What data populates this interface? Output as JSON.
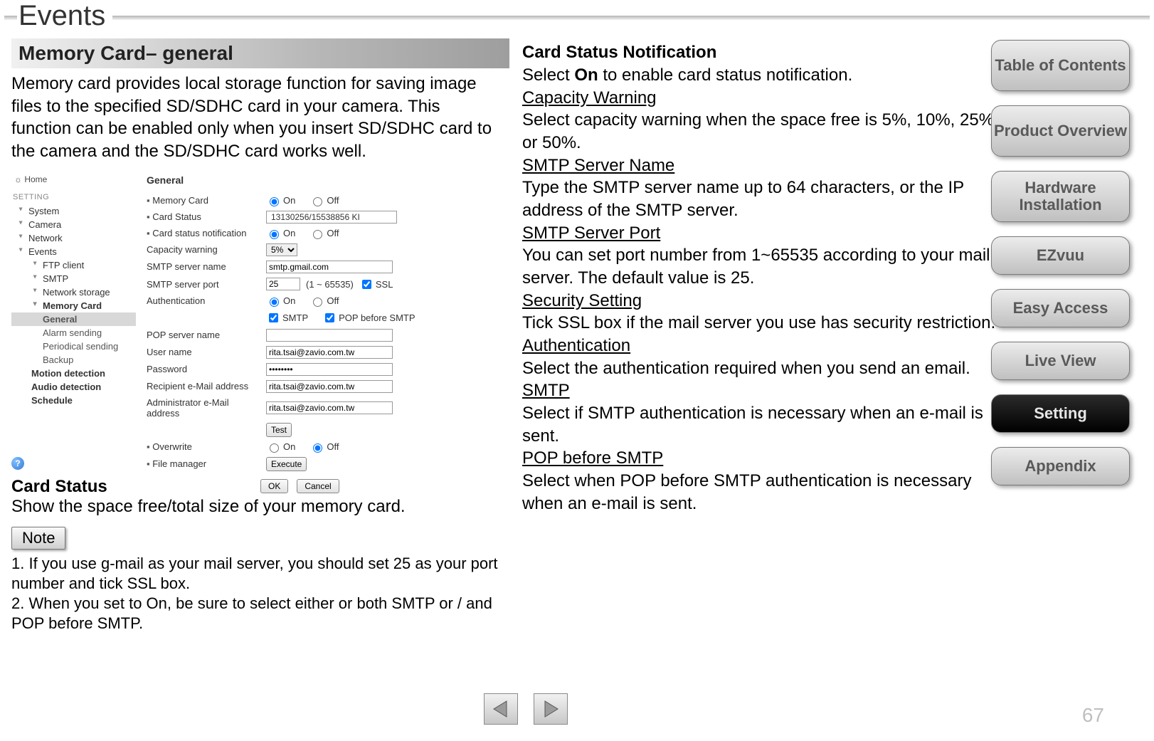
{
  "page_title": "Events",
  "page_number": "67",
  "section_header": "Memory Card– general",
  "intro_text": "Memory card provides local storage function for saving image files to the specified SD/SDHC card in your camera. This function can be enabled only when you insert SD/SDHC card to the camera and the SD/SDHC card works well.",
  "card_status": {
    "heading": "Card Status",
    "text": "Show the space free/total size of your memory card."
  },
  "note": {
    "label": "Note",
    "line1": "1. If you use g-mail as your mail server, you should set 25 as your port number and tick SSL box.",
    "line2": "2. When you set to On, be sure to select either or both SMTP or / and POP before SMTP."
  },
  "mid": {
    "h1": "Card Status Notification",
    "p1a": "Select ",
    "p1b": "On",
    "p1c": " to enable card status notification.",
    "h2": "Capacity Warning",
    "p2": "Select capacity warning when the space free is 5%, 10%, 25% or 50%.",
    "h3": "SMTP Server Name",
    "p3": "Type the SMTP server name up to 64 characters, or the IP address of the SMTP server.",
    "h4": "SMTP Server Port",
    "p4": "You can set port number from 1~65535 according to your mail server. The default value is 25.",
    "h5": "Security Setting",
    "p5": "Tick SSL box if the mail server you use has security restriction.",
    "h6": "Authentication",
    "p6": "Select the authentication required when you send an email.",
    "h7": "SMTP",
    "p7": "Select if SMTP authentication is necessary when an e-mail is sent.",
    "h8": "POP before SMTP",
    "p8": "Select when POP before SMTP authentication is necessary when an e-mail is sent."
  },
  "nav": {
    "toc": "Table of Contents",
    "product": "Product Overview",
    "hardware": "Hardware Installation",
    "ezvuu": "EZvuu",
    "easy": "Easy Access",
    "live": "Live View",
    "setting": "Setting",
    "appendix": "Appendix"
  },
  "embedded": {
    "home": "Home",
    "setting_label": "SETTING",
    "tree": {
      "system": "System",
      "camera": "Camera",
      "network": "Network",
      "events": "Events",
      "ftp": "FTP client",
      "smtp": "SMTP",
      "netstore": "Network storage",
      "memcard": "Memory Card",
      "general": "General",
      "alarm": "Alarm sending",
      "periodical": "Periodical sending",
      "backup": "Backup",
      "motion": "Motion detection",
      "audio": "Audio detection",
      "schedule": "Schedule"
    },
    "form": {
      "title": "General",
      "memory_card_label": "Memory Card",
      "on": "On",
      "off": "Off",
      "card_status_label": "Card Status",
      "card_status_value": "13130256/15538856 KI",
      "notification_label": "Card status notification",
      "capacity_label": "Capacity warning",
      "capacity_value": "5%",
      "smtp_name_label": "SMTP server name",
      "smtp_name_value": "smtp.gmail.com",
      "smtp_port_label": "SMTP server port",
      "smtp_port_value": "25",
      "smtp_port_hint": "(1 ~ 65535)",
      "ssl_label": "SSL",
      "auth_label": "Authentication",
      "smtp_cb": "SMTP",
      "pop_cb": "POP before SMTP",
      "pop_server_label": "POP server name",
      "user_label": "User name",
      "user_value": "rita.tsai@zavio.com.tw",
      "pass_label": "Password",
      "pass_value": "••••••••",
      "recip_label": "Recipient e-Mail address",
      "recip_value": "rita.tsai@zavio.com.tw",
      "admin_label": "Administrator e-Mail address",
      "admin_value": "rita.tsai@zavio.com.tw",
      "test_btn": "Test",
      "overwrite_label": "Overwrite",
      "file_mgr_label": "File manager",
      "execute_btn": "Execute",
      "ok_btn": "OK",
      "cancel_btn": "Cancel"
    }
  }
}
